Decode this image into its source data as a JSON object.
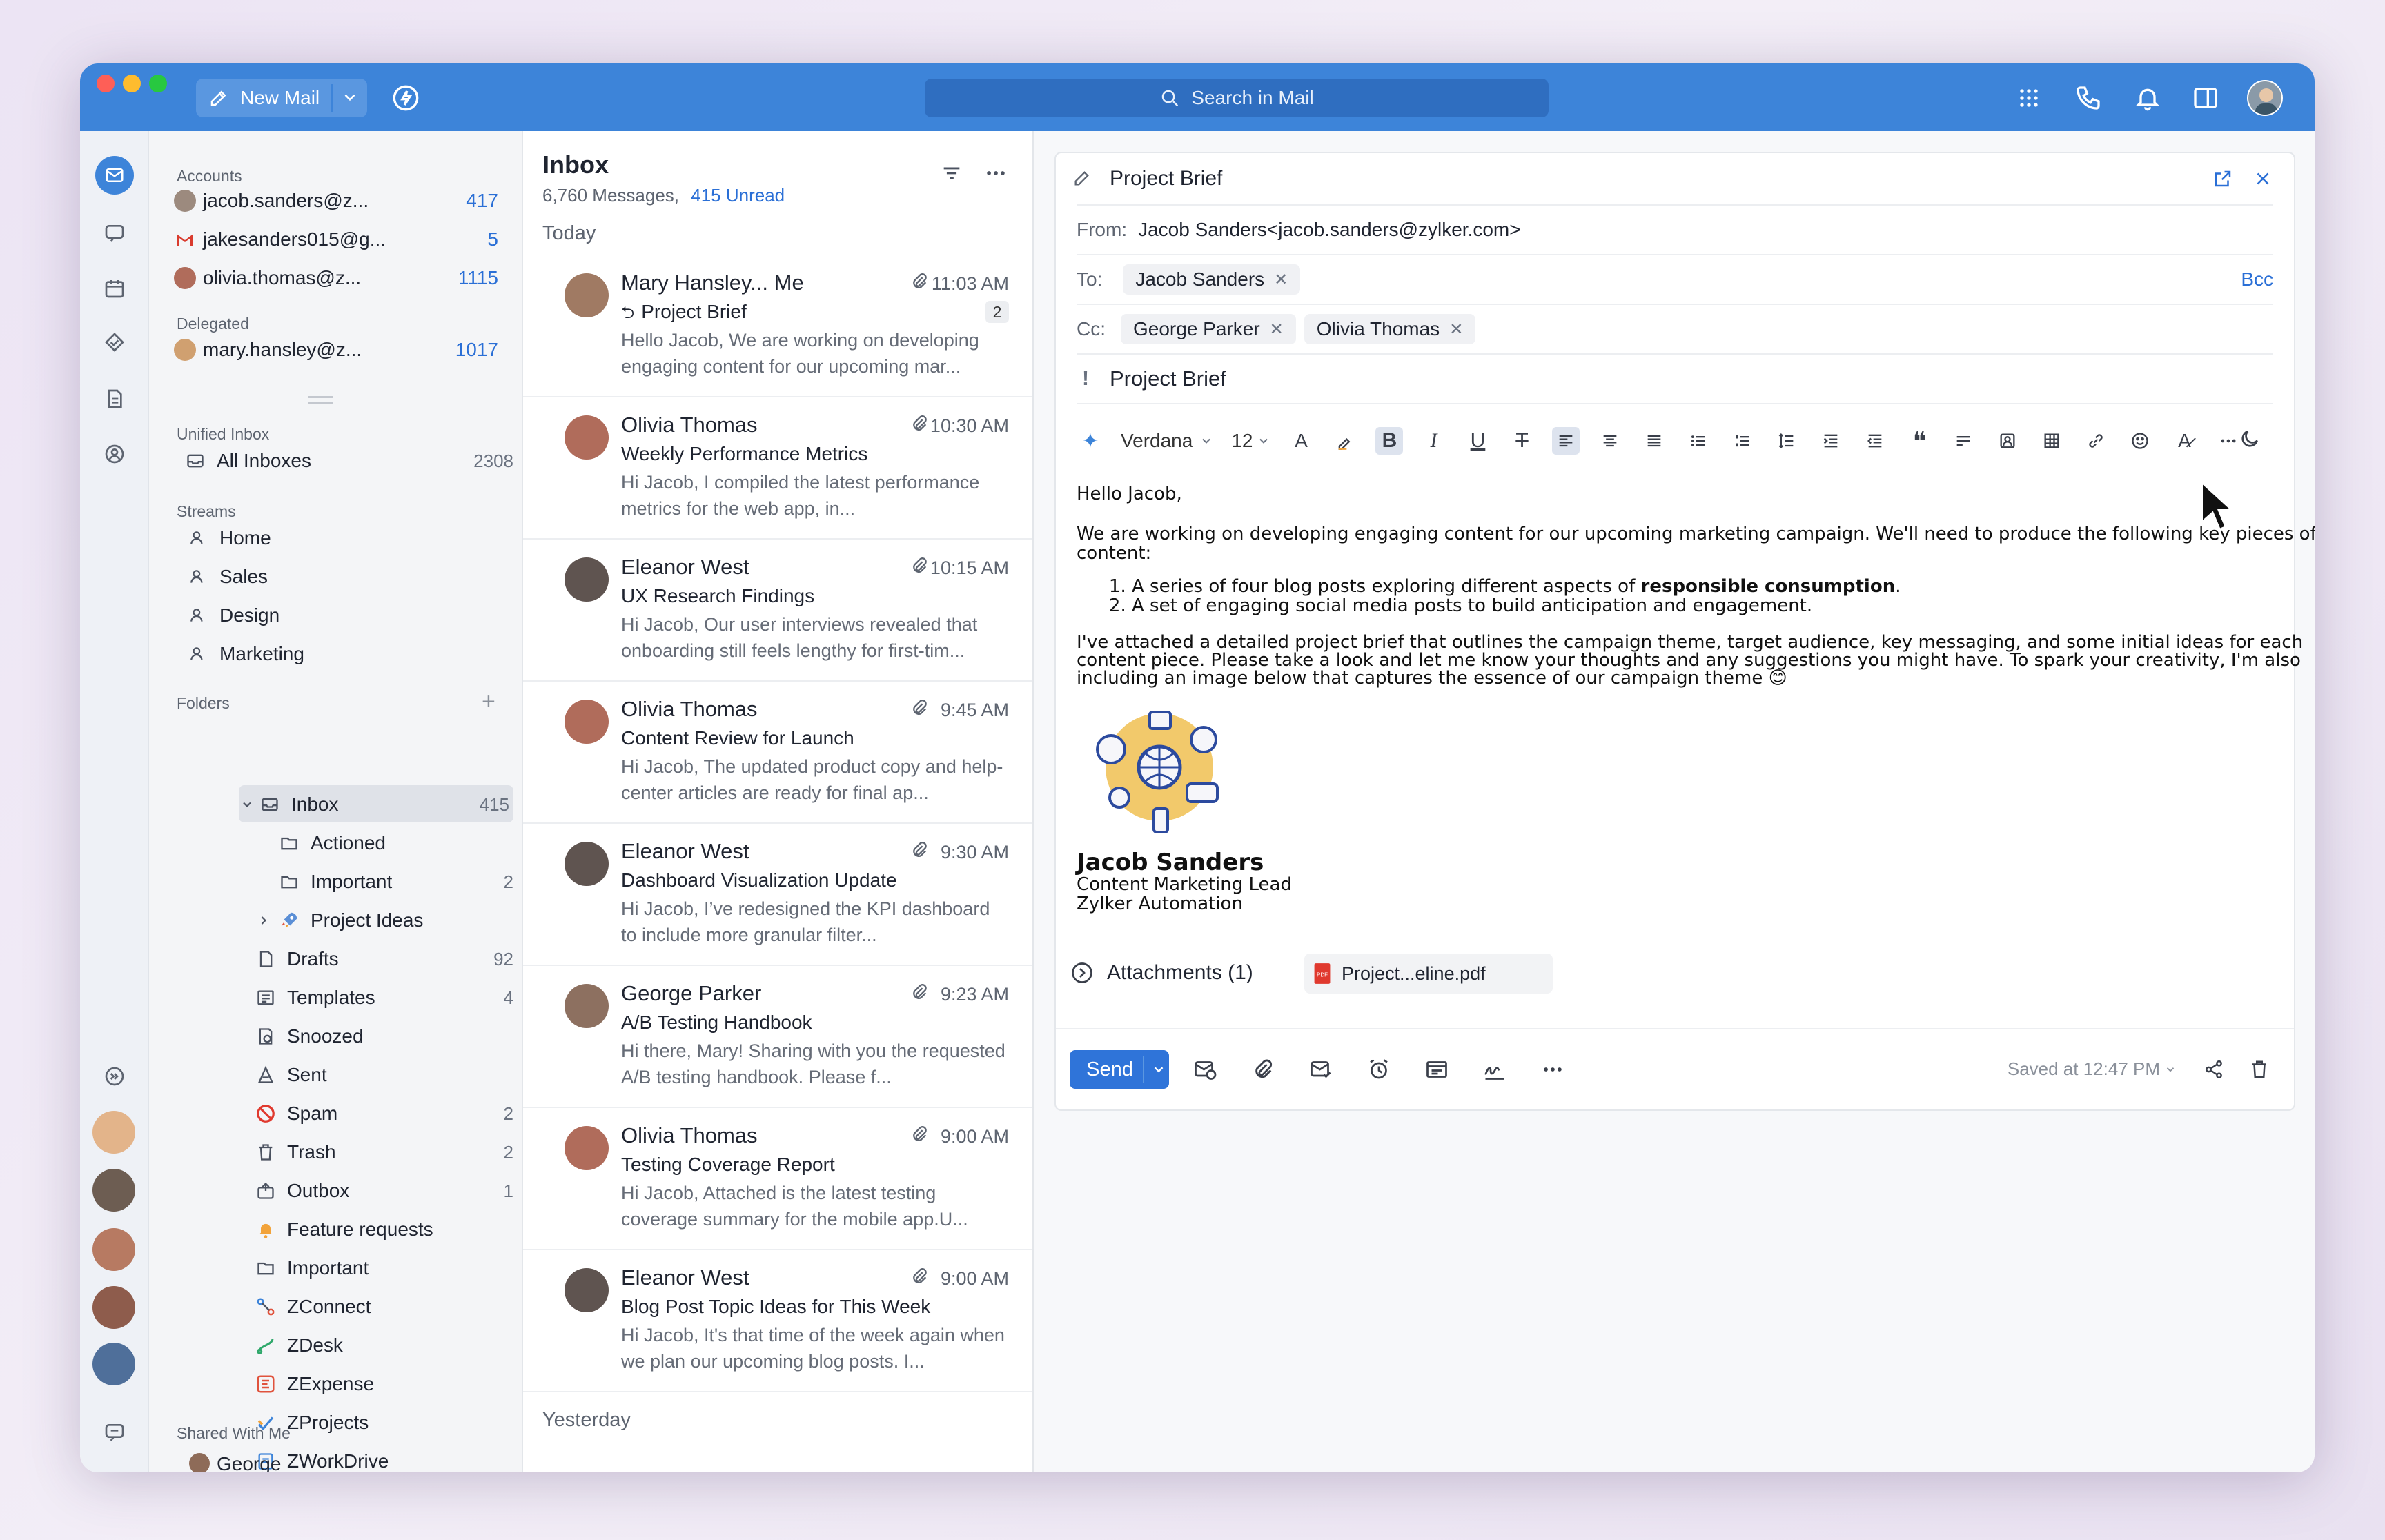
{
  "window": {
    "new_mail_label": "New Mail",
    "search_placeholder": "Search in Mail"
  },
  "sidebar": {
    "accounts_title": "Accounts",
    "accounts": [
      {
        "label": "jacob.sanders@z...",
        "count": "417"
      },
      {
        "label": "jakesanders015@g...",
        "count": "5"
      },
      {
        "label": "olivia.thomas@z...",
        "count": "1115"
      }
    ],
    "delegated_title": "Delegated",
    "delegated": [
      {
        "label": "mary.hansley@z...",
        "count": "1017"
      }
    ],
    "unified_title": "Unified Inbox",
    "all_inboxes": {
      "label": "All Inboxes",
      "count": "2308"
    },
    "streams_title": "Streams",
    "streams": [
      "Home",
      "Sales",
      "Design",
      "Marketing"
    ],
    "folders_title": "Folders",
    "folders": [
      {
        "label": "Inbox",
        "count": "415",
        "icon": "inbox-icon"
      },
      {
        "label": "Actioned",
        "count": "",
        "icon": "folder-icon"
      },
      {
        "label": "Important",
        "count": "2",
        "icon": "folder-icon"
      },
      {
        "label": "Project Ideas",
        "count": "",
        "icon": "rocket-icon"
      },
      {
        "label": "Drafts",
        "count": "92",
        "icon": "draft-icon"
      },
      {
        "label": "Templates",
        "count": "4",
        "icon": "template-icon"
      },
      {
        "label": "Snoozed",
        "count": "",
        "icon": "snooze-icon"
      },
      {
        "label": "Sent",
        "count": "",
        "icon": "sent-icon"
      },
      {
        "label": "Spam",
        "count": "2",
        "icon": "spam-icon"
      },
      {
        "label": "Trash",
        "count": "2",
        "icon": "trash-icon"
      },
      {
        "label": "Outbox",
        "count": "1",
        "icon": "outbox-icon"
      },
      {
        "label": "Feature requests",
        "count": "",
        "icon": "bell-icon"
      },
      {
        "label": "Important",
        "count": "",
        "icon": "folder-icon"
      },
      {
        "label": "ZConnect",
        "count": "",
        "icon": "zconnect-icon"
      },
      {
        "label": "ZDesk",
        "count": "",
        "icon": "zdesk-icon"
      },
      {
        "label": "ZExpense",
        "count": "",
        "icon": "zexpense-icon"
      },
      {
        "label": "ZProjects",
        "count": "",
        "icon": "zprojects-icon"
      },
      {
        "label": "ZWorkDrive",
        "count": "",
        "icon": "zworkdrive-icon"
      }
    ],
    "shared_title": "Shared With Me",
    "shared_first": "George"
  },
  "list": {
    "title": "Inbox",
    "messages_count": "6,760 Messages,",
    "unread_count": "415 Unread",
    "today_label": "Today",
    "yesterday_label": "Yesterday",
    "items": [
      {
        "sender": "Mary Hansley... Me",
        "time": "11:03 AM",
        "subject": "Project Brief",
        "preview": "Hello Jacob, We are working on developing engaging content for our upcoming mar...",
        "badge": "2"
      },
      {
        "sender": "Olivia Thomas",
        "time": "10:30 AM",
        "subject": "Weekly Performance Metrics",
        "preview": "Hi Jacob, I compiled the latest performance metrics for the web app, in...",
        "badge": ""
      },
      {
        "sender": "Eleanor West",
        "time": "10:15 AM",
        "subject": "UX Research Findings",
        "preview": "Hi Jacob, Our user interviews revealed that onboarding still feels lengthy for first-tim...",
        "badge": ""
      },
      {
        "sender": "Olivia Thomas",
        "time": "9:45 AM",
        "subject": "Content Review for Launch",
        "preview": "Hi Jacob, The updated product copy and help-center articles are ready for final ap...",
        "badge": ""
      },
      {
        "sender": "Eleanor West",
        "time": "9:30 AM",
        "subject": "Dashboard Visualization Update",
        "preview": "Hi Jacob, I’ve redesigned the KPI dashboard to include more granular filter...",
        "badge": ""
      },
      {
        "sender": "George Parker",
        "time": "9:23 AM",
        "subject": "A/B Testing Handbook",
        "preview": "Hi there, Mary! Sharing with you the requested A/B testing handbook. Please f...",
        "badge": ""
      },
      {
        "sender": "Olivia Thomas",
        "time": "9:00 AM",
        "subject": "Testing Coverage Report",
        "preview": "Hi Jacob, Attached is the latest testing coverage summary for the mobile app.U...",
        "badge": ""
      },
      {
        "sender": "Eleanor West",
        "time": "9:00 AM",
        "subject": "Blog Post Topic Ideas for This Week",
        "preview": "Hi Jacob, It's that time of the week again when we plan our upcoming blog posts. I...",
        "badge": ""
      }
    ]
  },
  "compose": {
    "title": "Project Brief",
    "from_label": "From:",
    "from_value": "Jacob Sanders<jacob.sanders@zylker.com>",
    "to_label": "To:",
    "to": [
      "Jacob Sanders"
    ],
    "bcc_label": "Bcc",
    "cc_label": "Cc:",
    "cc": [
      "George Parker",
      "Olivia Thomas"
    ],
    "priority_mark": "!",
    "subject": "Project Brief",
    "font_name": "Verdana",
    "font_size": "12",
    "greeting": "Hello Jacob,",
    "para1": "We are working on developing engaging content for our upcoming marketing campaign. We'll need to produce the following key pieces of content:",
    "li1_start": "A series of four blog posts exploring different aspects of ",
    "li1_bold": "responsible consumption",
    "li1_end": ".",
    "li2": "A set of engaging social media posts to build anticipation and engagement.",
    "para2": "I've attached a detailed project brief that outlines the campaign theme, target audience, key messaging, and some initial ideas for each content piece. Please take a look and let me know your thoughts and any suggestions you might have. To spark your creativity, I'm also including an image below that captures the essence of our campaign theme 😊",
    "sig_name": "Jacob Sanders",
    "sig_title": "Content Marketing Lead",
    "sig_company": "Zylker Automation",
    "attachments_label": "Attachments (1)",
    "attachment_file": "Project...eline.pdf",
    "send_label": "Send",
    "saved_label": "Saved at 12:47 PM"
  },
  "colors": {
    "accent": "#3d84d9",
    "send": "#2f74d9",
    "count": "#2a6fd6"
  }
}
